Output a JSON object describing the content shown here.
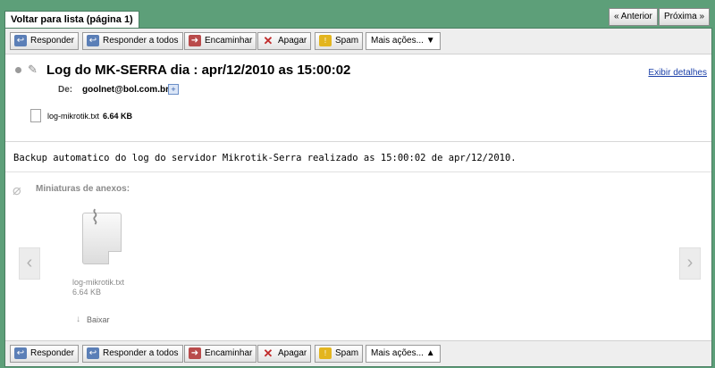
{
  "nav": {
    "back_tab": "Voltar para lista (página 1)",
    "prev": "« Anterior",
    "next": "Próxima »"
  },
  "toolbar": {
    "reply": "Responder",
    "reply_all": "Responder a todos",
    "forward": "Encaminhar",
    "delete": "Apagar",
    "spam": "Spam",
    "more_top": "Mais ações... ▼",
    "more_bottom": "Mais ações... ▲"
  },
  "message": {
    "subject": "Log do MK-SERRA dia : apr/12/2010 as 15:00:02",
    "details_link": "Exibir detalhes",
    "from_label": "De:",
    "from": "goolnet@bol.com.br",
    "attachment_name": "log-mikrotik.txt",
    "attachment_size": "6.64 KB",
    "body": "Backup automatico do log do servidor Mikrotik-Serra realizado as 15:00:02 de apr/12/2010."
  },
  "thumbnails": {
    "label": "Miniaturas de anexos:",
    "file_name": "log-mikrotik.txt",
    "file_size": "6.64 KB",
    "download": "Baixar"
  },
  "icons": [
    "paperclip-icon",
    "reply-icon",
    "reply-all-icon",
    "forward-icon",
    "delete-icon",
    "spam-icon",
    "add-contact-icon",
    "file-icon",
    "download-icon"
  ],
  "colors": {
    "frame": "#5d9f79",
    "link": "#1a3fa8"
  }
}
